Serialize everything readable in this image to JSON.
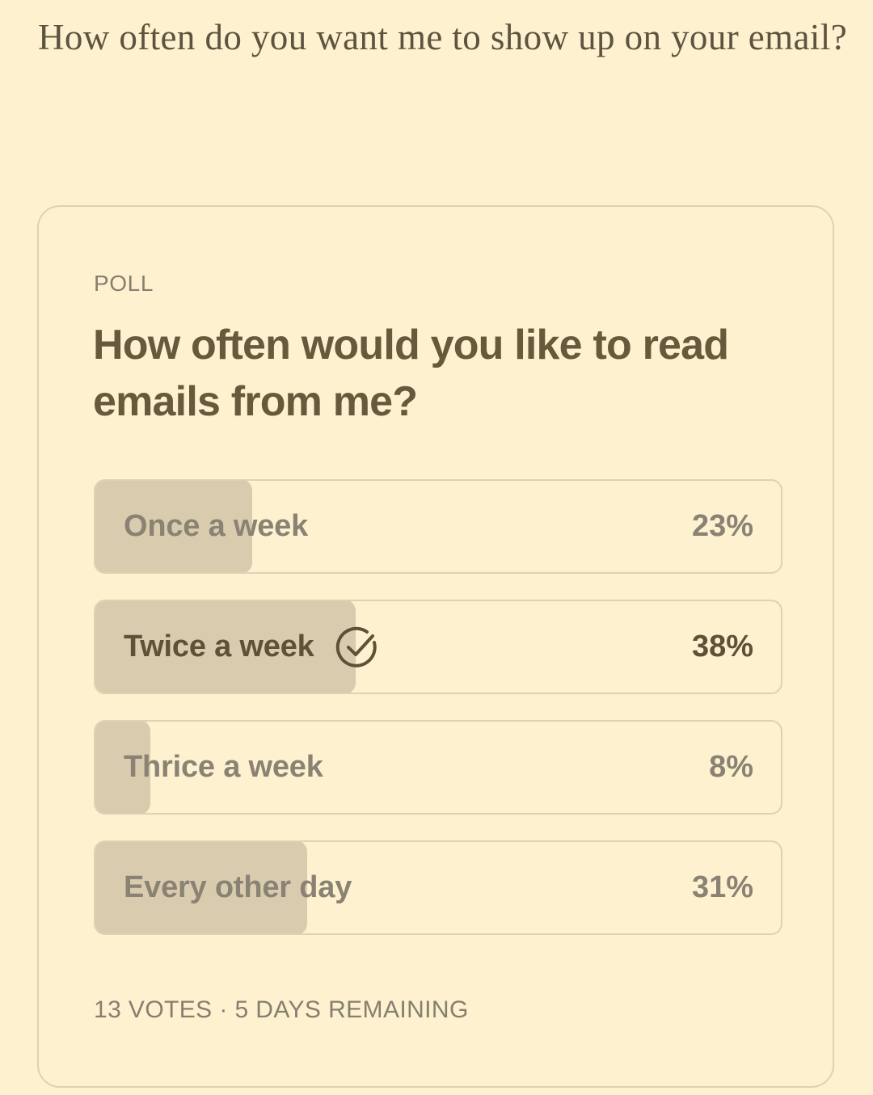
{
  "intro": {
    "text": "How often do you want me to show up on your email?"
  },
  "poll": {
    "label": "POLL",
    "question": "How often would you like to read emails from me?",
    "options": [
      {
        "label": "Once a week",
        "percent": 23,
        "percent_text": "23%",
        "selected": false
      },
      {
        "label": "Twice a week",
        "percent": 38,
        "percent_text": "38%",
        "selected": true,
        "icon": "check-circle-icon"
      },
      {
        "label": "Thrice a week",
        "percent": 8,
        "percent_text": "8%",
        "selected": false
      },
      {
        "label": "Every other day",
        "percent": 31,
        "percent_text": "31%",
        "selected": false
      }
    ],
    "footer": "13 VOTES · 5 DAYS REMAINING"
  },
  "colors": {
    "background": "#fdf1cf",
    "bar_fill": "#d9cbae",
    "border": "#ded2b0",
    "heading": "#675a3c",
    "muted": "#8a8374",
    "selected_text": "#5d5236"
  }
}
